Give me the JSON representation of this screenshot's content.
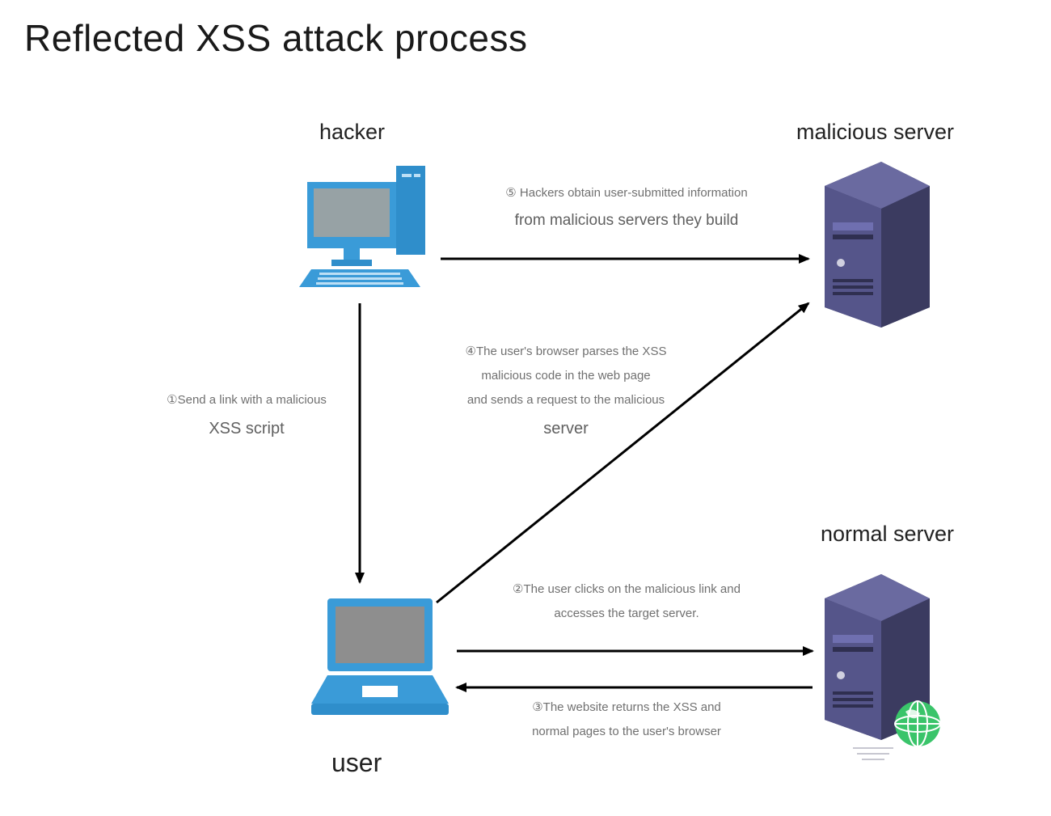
{
  "title": "Reflected XSS attack process",
  "nodes": {
    "hacker": {
      "label": "hacker"
    },
    "malicious_server": {
      "label": "malicious server"
    },
    "normal_server": {
      "label": "normal server"
    },
    "user": {
      "label": "user"
    }
  },
  "steps": {
    "step1": {
      "prefix": "①",
      "line1": "Send a link with a malicious",
      "line2": "XSS script"
    },
    "step2": {
      "prefix": "②",
      "line1": "The user clicks on the malicious link and",
      "line2": "accesses the target server."
    },
    "step3": {
      "prefix": "③",
      "line1": "The website returns the XSS and",
      "line2": "normal pages to the user's browser"
    },
    "step4": {
      "prefix": "④",
      "line1": "The user's browser parses the XSS",
      "line2": "malicious code in the web page",
      "line3": "and sends a request to the malicious",
      "line4": "server"
    },
    "step5": {
      "prefix": "⑤",
      "line1": " Hackers obtain user-submitted information",
      "line2": "from malicious servers they build"
    }
  }
}
